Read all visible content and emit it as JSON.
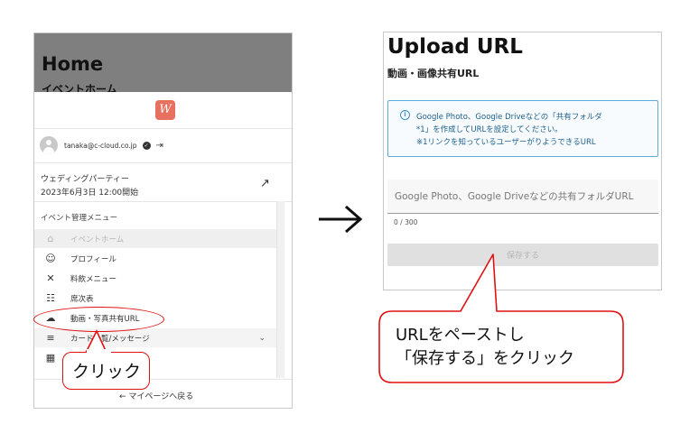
{
  "left": {
    "title": "Home",
    "subtitle": "イベントホーム",
    "logo_text": "W",
    "user_email": "tanaka@c-cloud.co.jp",
    "event_name": "ウェディングパーティー",
    "event_date": "2023年6月3日 12:00開始",
    "menu_heading": "イベント管理メニュー",
    "menu_items": [
      {
        "icon": "⌂",
        "label": "イベントホーム"
      },
      {
        "icon": "☺",
        "label": "プロフィール"
      },
      {
        "icon": "✕",
        "label": "料飲メニュー"
      },
      {
        "icon": "☷",
        "label": "席次表"
      },
      {
        "icon": "☁",
        "label": "動画・写真共有URL"
      },
      {
        "icon": "≡",
        "label": "カード一覧/メッセージ"
      },
      {
        "icon": "▦",
        "label": ""
      }
    ],
    "back_link": "← マイページへ戻る"
  },
  "annotations": {
    "click_label": "クリック",
    "paste_line1": "URLをペーストし",
    "paste_line2": "「保存する」をクリック",
    "accent_color": "#e01010"
  },
  "right": {
    "title": "Upload URL",
    "subtitle": "動画・画像共有URL",
    "info_line1": "Google Photo、Google Driveなどの「共有フォルダ",
    "info_line2": "*1」を作成してURLを設定してください。",
    "info_line3": "※1リンクを知っているユーザーがりようできるURL",
    "input_placeholder": "Google Photo、Google Driveなどの共有フォルダURL",
    "char_count": "0 / 300",
    "save_label": "保存する"
  }
}
